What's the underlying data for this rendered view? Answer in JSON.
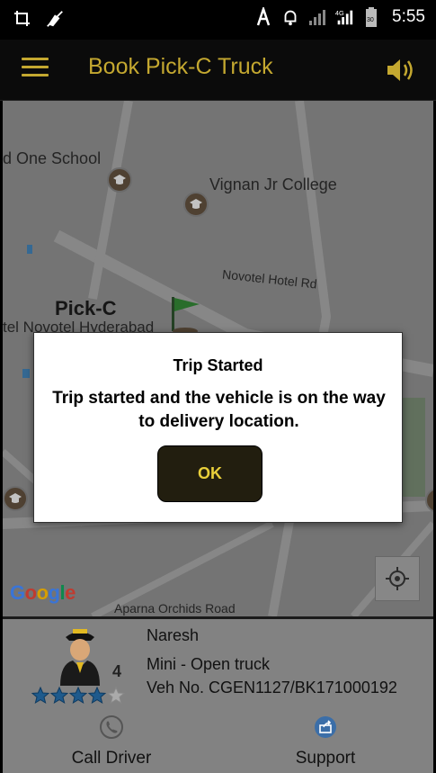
{
  "status_bar": {
    "time": "5:55",
    "network": "4G",
    "battery": "30"
  },
  "app_bar": {
    "title": "Book Pick-C Truck",
    "menu_icon": "hamburger-menu-icon",
    "sound_icon": "speaker-icon"
  },
  "map": {
    "labels": [
      "d One School",
      "Vignan Jr College",
      "Novotel Hotel Rd",
      "Pick-C",
      "tel Novotel Hyderabad",
      "Aparna Orchids Road"
    ],
    "google": [
      "G",
      "o",
      "o",
      "g",
      "l",
      "e"
    ],
    "google_colors": [
      "#4285f4",
      "#db4437",
      "#f4b400",
      "#4285f4",
      "#0f9d58",
      "#db4437"
    ]
  },
  "dialog": {
    "title": "Trip Started",
    "message": "Trip started and the vehicle is on the way to delivery location.",
    "ok_label": "OK"
  },
  "driver": {
    "name": "Naresh",
    "vehicle_type": "Mini - Open truck",
    "vehicle_no": "Veh No. CGEN1127/BK171000192",
    "rating": "4",
    "rating_value": 4,
    "rating_max": 5
  },
  "actions": {
    "call_label": "Call Driver",
    "support_label": "Support"
  },
  "colors": {
    "accent": "#c4a830",
    "ok_text": "#e8cf3a",
    "star": "#1e5a8c"
  }
}
